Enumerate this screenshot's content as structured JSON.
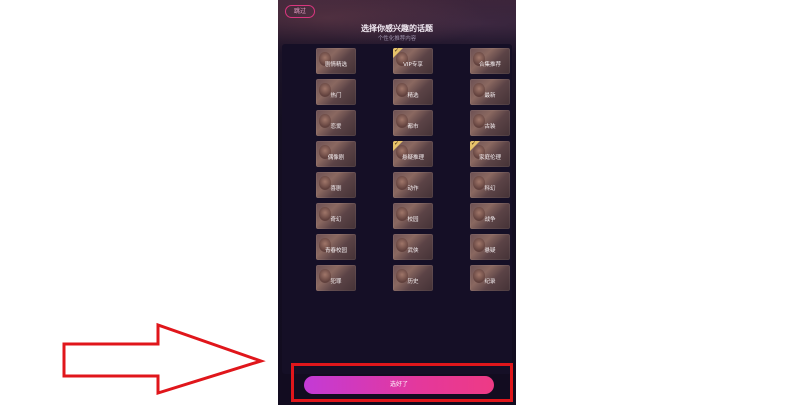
{
  "header": {
    "skip_label": "跳过",
    "title": "选择你感兴趣的话题",
    "subtitle": "个性化推荐内容"
  },
  "tiles": [
    {
      "label": "剧情精选",
      "selected": false
    },
    {
      "label": "VIP专享",
      "selected": true
    },
    {
      "label": "合集推荐",
      "selected": false
    },
    {
      "label": "热门",
      "selected": false
    },
    {
      "label": "精选",
      "selected": false
    },
    {
      "label": "最新",
      "selected": false
    },
    {
      "label": "恋爱",
      "selected": false
    },
    {
      "label": "都市",
      "selected": false
    },
    {
      "label": "古装",
      "selected": false
    },
    {
      "label": "偶像剧",
      "selected": false
    },
    {
      "label": "悬疑推理",
      "selected": true
    },
    {
      "label": "家庭伦理",
      "selected": true
    },
    {
      "label": "喜剧",
      "selected": false
    },
    {
      "label": "动作",
      "selected": false
    },
    {
      "label": "科幻",
      "selected": false
    },
    {
      "label": "奇幻",
      "selected": false
    },
    {
      "label": "校园",
      "selected": false
    },
    {
      "label": "战争",
      "selected": false
    },
    {
      "label": "青春校园",
      "selected": false
    },
    {
      "label": "武侠",
      "selected": false
    },
    {
      "label": "悬疑",
      "selected": false
    },
    {
      "label": "犯罪",
      "selected": false
    },
    {
      "label": "历史",
      "selected": false
    },
    {
      "label": "纪录",
      "selected": false
    }
  ],
  "footer": {
    "confirm_label": "选好了"
  },
  "colors": {
    "accent_pink": "#e4389c",
    "accent_purple": "#c33ad6",
    "annotation_red": "#e0161b",
    "selected_badge": "#e6c26a"
  },
  "annotation": {
    "arrow_icon": "red-outline-right-arrow"
  }
}
